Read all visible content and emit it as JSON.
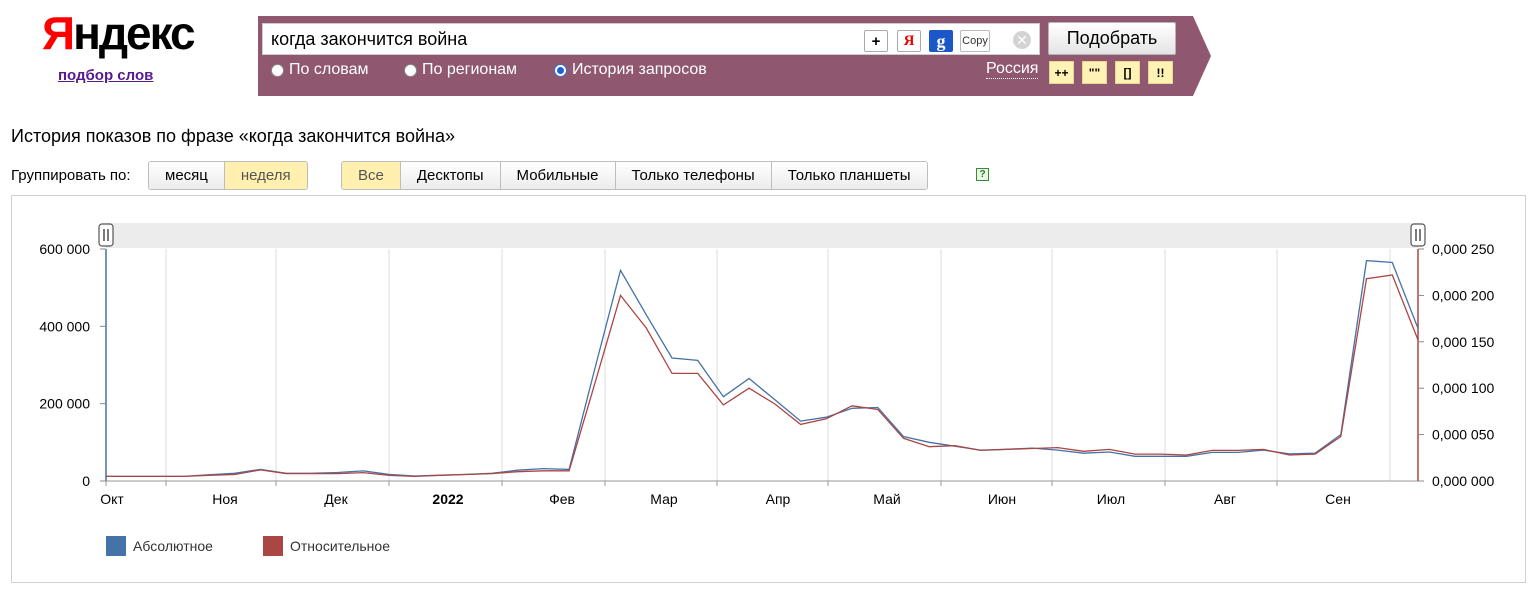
{
  "logo": {
    "text_first": "Я",
    "text_rest": "ндекс",
    "subtitle": "подбор слов"
  },
  "search": {
    "value": "когда закончится война",
    "plus_label": "+",
    "ya_label": "Я",
    "g_label": "g",
    "copy_label": "Copy",
    "clear_label": "✕",
    "submit_label": "Подобрать"
  },
  "modes": [
    {
      "label": "По словам",
      "selected": false
    },
    {
      "label": "По регионам",
      "selected": false
    },
    {
      "label": "История запросов",
      "selected": true
    }
  ],
  "region": "Россия",
  "operators": [
    "++",
    "\"\"",
    "[]",
    "!!"
  ],
  "heading": "История показов по фразе «когда закончится война»",
  "group": {
    "label": "Группировать по:",
    "options": [
      {
        "label": "месяц",
        "active": false
      },
      {
        "label": "неделя",
        "active": true
      }
    ]
  },
  "devices": [
    {
      "label": "Все",
      "active": true
    },
    {
      "label": "Десктопы",
      "active": false
    },
    {
      "label": "Мобильные",
      "active": false
    },
    {
      "label": "Только телефоны",
      "active": false
    },
    {
      "label": "Только планшеты",
      "active": false
    }
  ],
  "help_label": "?",
  "colors": {
    "panel": "#8f5870",
    "absolute": "#4572a7",
    "relative": "#aa4643"
  },
  "chart_data": {
    "type": "line",
    "x_labels": [
      "Окт",
      "Ноя",
      "Дек",
      "2022",
      "Фев",
      "Мар",
      "Апр",
      "Май",
      "Июн",
      "Июл",
      "Авг",
      "Сен"
    ],
    "y_left_ticks": [
      "0",
      "200 000",
      "400 000",
      "600 000"
    ],
    "y_right_ticks": [
      "0,000 000",
      "0,000 050",
      "0,000 100",
      "0,000 150",
      "0,000 200",
      "0,000 250"
    ],
    "ylim_left": [
      0,
      600000
    ],
    "ylim_right": [
      0,
      0.00025
    ],
    "legend": [
      "Абсолютное",
      "Относительное"
    ],
    "series": [
      {
        "name": "Абсолютное",
        "axis": "left",
        "values": [
          12000,
          12000,
          12000,
          12000,
          16000,
          20000,
          30000,
          20000,
          20000,
          22000,
          26000,
          17000,
          13000,
          15000,
          17000,
          20000,
          28000,
          32000,
          30000,
          290000,
          545000,
          430000,
          318000,
          312000,
          218000,
          265000,
          210000,
          155000,
          165000,
          188000,
          190000,
          115000,
          100000,
          90000,
          80000,
          82000,
          85000,
          80000,
          72000,
          75000,
          64000,
          64000,
          64000,
          74000,
          74000,
          80000,
          70000,
          72000,
          120000,
          570000,
          565000,
          395000
        ]
      },
      {
        "name": "Относительное",
        "axis": "right",
        "values": [
          5e-06,
          5e-06,
          5e-06,
          5e-06,
          6e-06,
          7e-06,
          1.2e-05,
          8e-06,
          8e-06,
          8e-06,
          9e-06,
          6e-06,
          5e-06,
          6e-06,
          7e-06,
          8e-06,
          1e-05,
          1.1e-05,
          1.1e-05,
          0.000105,
          0.0002,
          0.000165,
          0.000116,
          0.000116,
          8.2e-05,
          0.0001,
          8.3e-05,
          6.1e-05,
          6.7e-05,
          8.1e-05,
          7.7e-05,
          4.6e-05,
          3.7e-05,
          3.8e-05,
          3.3e-05,
          3.4e-05,
          3.5e-05,
          3.6e-05,
          3.2e-05,
          3.4e-05,
          2.9e-05,
          2.9e-05,
          2.8e-05,
          3.3e-05,
          3.3e-05,
          3.4e-05,
          2.8e-05,
          2.9e-05,
          4.8e-05,
          0.000218,
          0.000222,
          0.000152
        ]
      }
    ]
  }
}
